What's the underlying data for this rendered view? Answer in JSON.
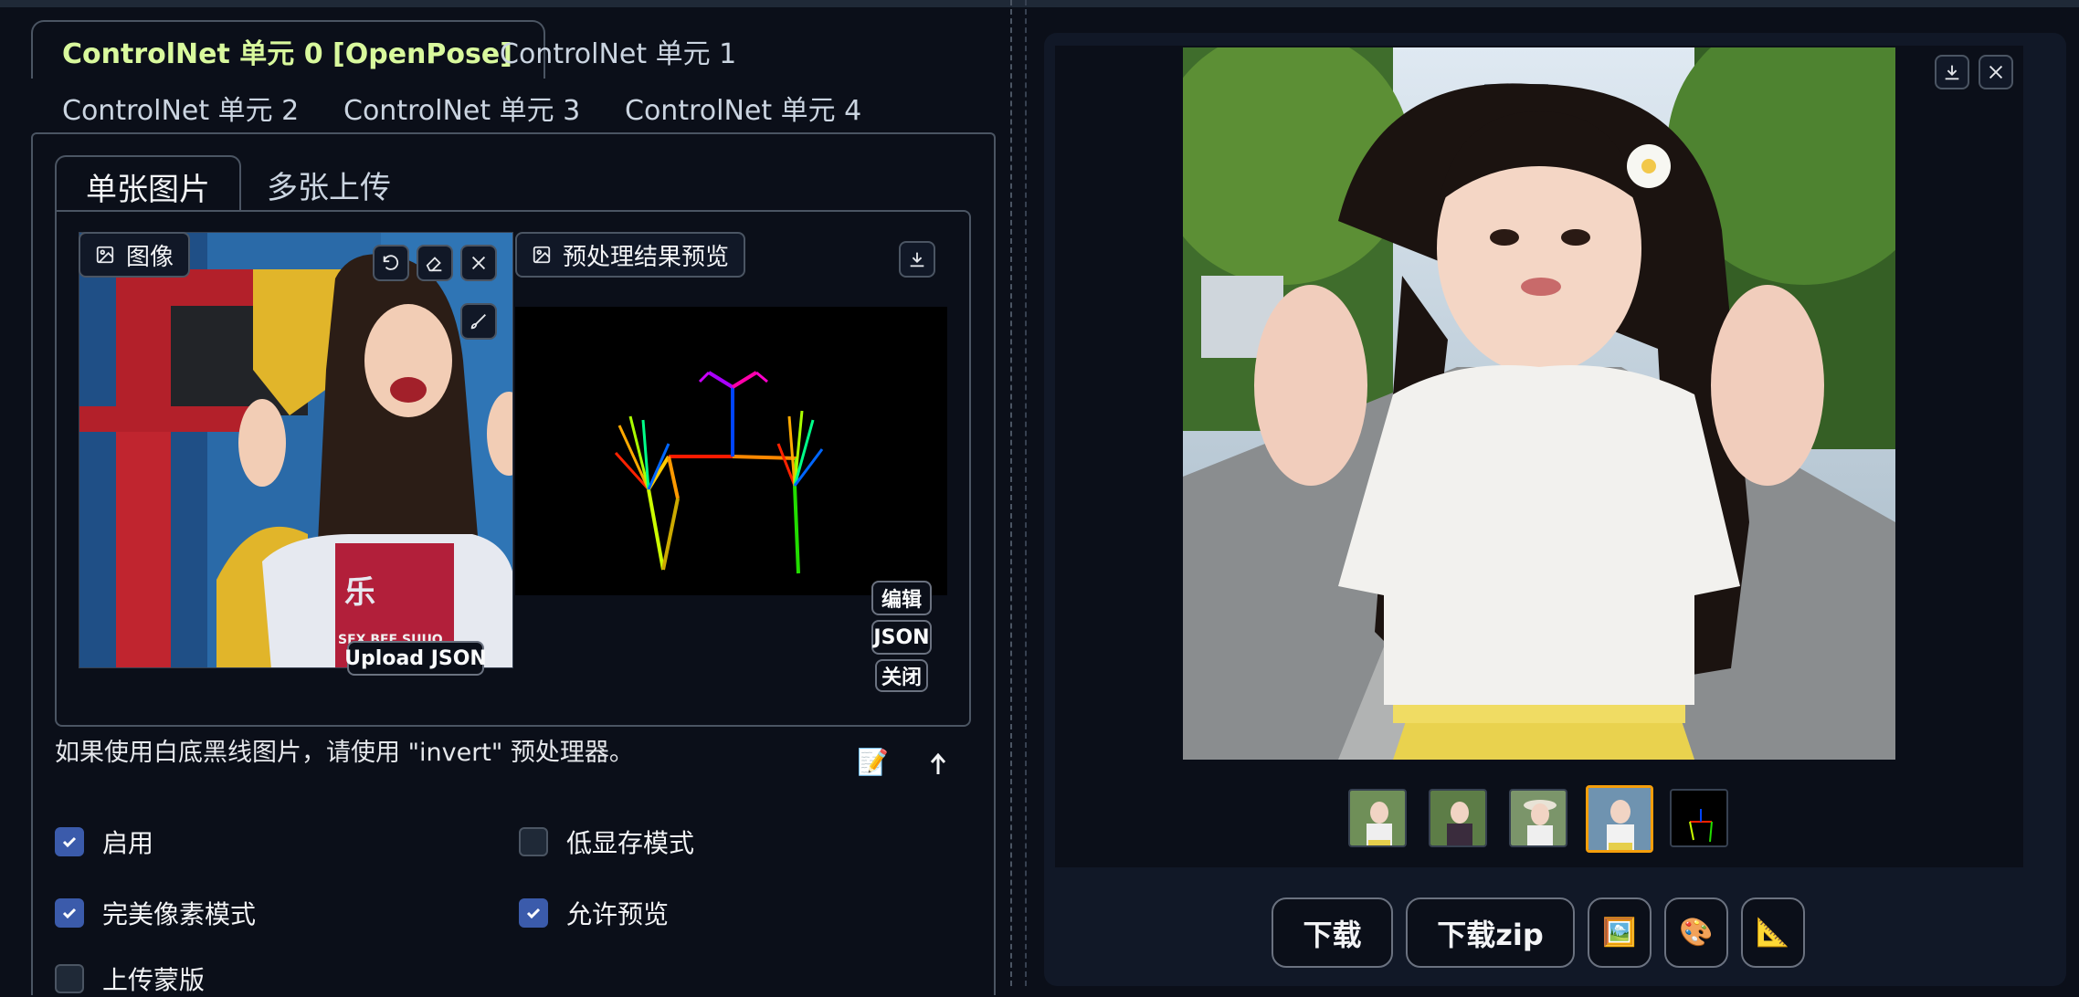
{
  "unit_tabs": [
    {
      "label": "ControlNet 单元 0 [OpenPose]",
      "active": true
    },
    {
      "label": "ControlNet 单元 1",
      "active": false
    },
    {
      "label": "ControlNet 单元 2",
      "active": false
    },
    {
      "label": "ControlNet 单元 3",
      "active": false
    },
    {
      "label": "ControlNet 单元 4",
      "active": false
    }
  ],
  "sub_tabs": [
    {
      "label": "单张图片",
      "active": true
    },
    {
      "label": "多张上传",
      "active": false
    }
  ],
  "input_image": {
    "label": "图像",
    "upload_json_label": "Upload JSON",
    "icons": [
      "undo-icon",
      "eraser-icon",
      "close-icon",
      "brush-icon"
    ]
  },
  "preview": {
    "label": "预处理结果预览",
    "edit_label": "编辑",
    "json_label": "JSON",
    "close_label": "关闭"
  },
  "hint_text": "如果使用白底黑线图片，请使用 \"invert\" 预处理器。",
  "hint_icons": [
    "memo-icon",
    "swap-arrow-icon"
  ],
  "checkboxes": [
    {
      "label": "启用",
      "checked": true
    },
    {
      "label": "低显存模式",
      "checked": false
    },
    {
      "label": "完美像素模式",
      "checked": true
    },
    {
      "label": "允许预览",
      "checked": true
    },
    {
      "label": "上传蒙版",
      "checked": false
    }
  ],
  "gallery": {
    "thumbnail_count": 5,
    "selected_index": 3,
    "buttons": {
      "download": "下载",
      "download_zip": "下载zip",
      "emoji_1": "🖼️",
      "emoji_2": "🎨",
      "emoji_3": "📐"
    }
  },
  "colors": {
    "background": "#0b0f19",
    "active_tab_text": "#d9f99d",
    "checkbox_accent": "#3b5bab",
    "border": "#4b5563"
  }
}
